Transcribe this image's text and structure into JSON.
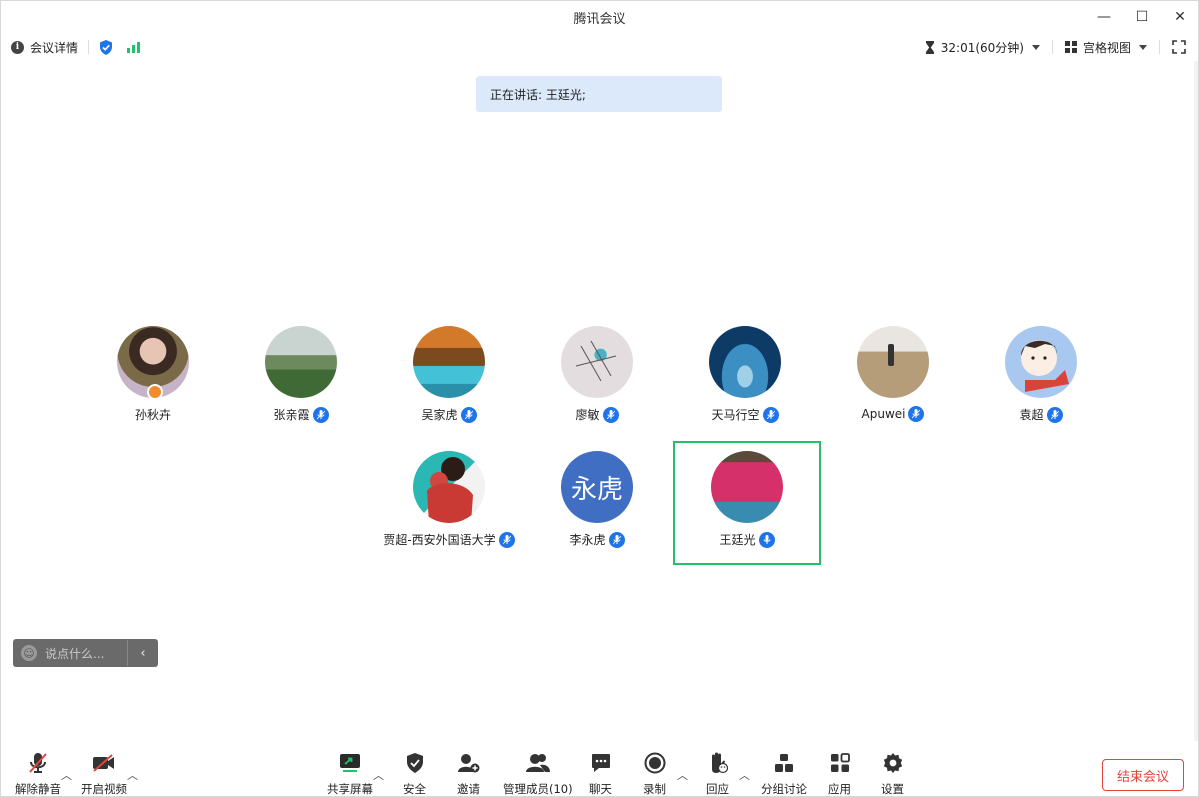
{
  "window": {
    "title": "腾讯会议"
  },
  "toolbar": {
    "meeting_details": "会议详情",
    "timer": "32:01(60分钟)",
    "view_mode": "宫格视图"
  },
  "banner": {
    "speaking_text": "正在讲话: 王廷光;"
  },
  "participants": [
    {
      "name": "孙秋卉",
      "icon": "host-badge-icon"
    },
    {
      "name": "张亲霞",
      "icon": "mic-icon"
    },
    {
      "name": "吴家虎",
      "icon": "mic-icon"
    },
    {
      "name": "廖敏",
      "icon": "mic-icon"
    },
    {
      "name": "天马行空",
      "icon": "mic-icon"
    },
    {
      "name": "Apuwei",
      "icon": "mic-icon"
    },
    {
      "name": "袁超",
      "icon": "mic-icon"
    },
    {
      "name": "贾超-西安外国语大学",
      "icon": "mic-icon"
    },
    {
      "name": "李永虎",
      "icon": "mic-icon",
      "avatar_text": "永虎"
    },
    {
      "name": "王廷光",
      "icon": "mic-speaking-icon",
      "active_speaker": true
    }
  ],
  "chat": {
    "placeholder": "说点什么..."
  },
  "controls": {
    "unmute": "解除静音",
    "start_video": "开启视频",
    "share_screen": "共享屏幕",
    "security": "安全",
    "invite": "邀请",
    "manage_members": "管理成员(10)",
    "chat": "聊天",
    "record": "录制",
    "reactions": "回应",
    "breakout": "分组讨论",
    "apps": "应用",
    "settings": "设置",
    "end_meeting": "结束会议"
  },
  "colors": {
    "accent": "#1e74e8",
    "active_border": "#22c06a",
    "end_red": "#e2453c",
    "banner_bg": "#dbe9fb"
  }
}
